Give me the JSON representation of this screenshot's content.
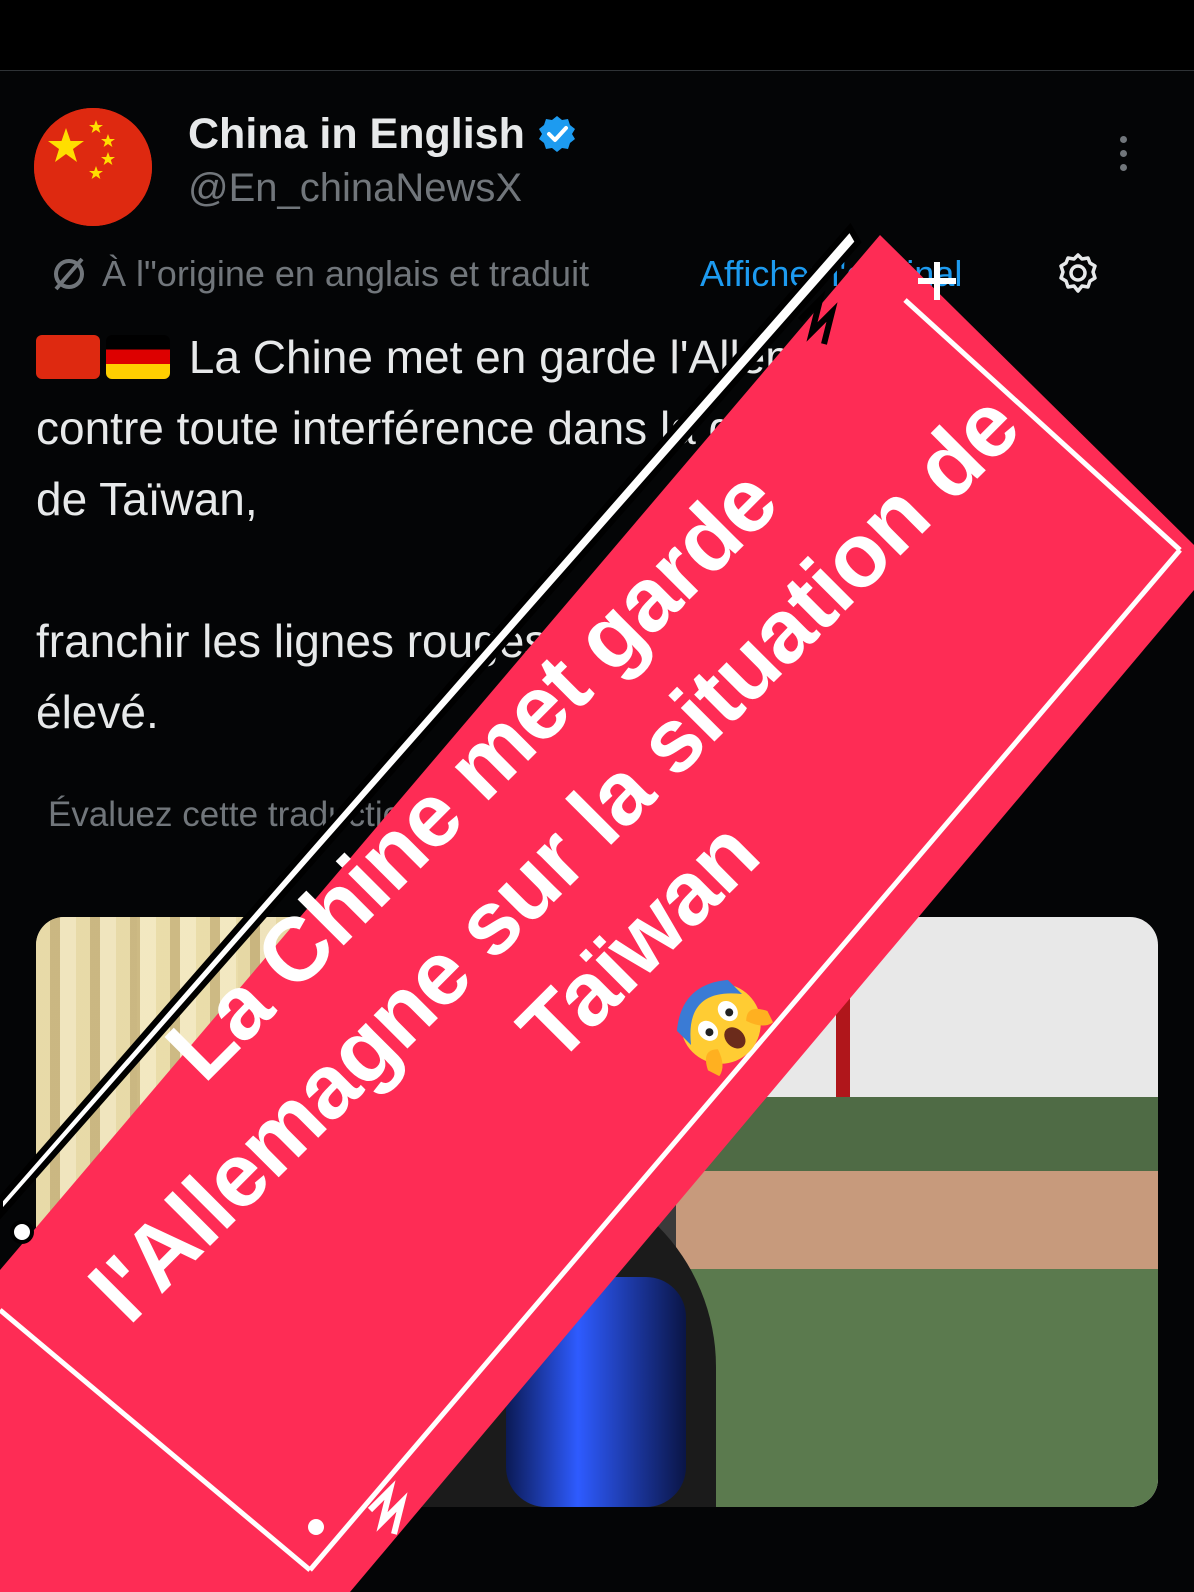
{
  "account": {
    "name": "China in English",
    "handle": "@En_chinaNewsX",
    "verified": true,
    "avatar_icon": "china-flag-icon",
    "verified_color": "#1d9bf0"
  },
  "translation_bar": {
    "text": "À l\"origine en anglais et traduit",
    "link": "Afficher l'original"
  },
  "post": {
    "line1_text": "La Chine met en garde l'Allemagne",
    "line2": "contre toute interférence dans la question",
    "line3": "de Taïwan,",
    "line5": "franchir les lignes rouges aura un coût",
    "line6": "élevé.",
    "rate_translation": "Évaluez cette traduction"
  },
  "overlay": {
    "line1": "La Chine met garde",
    "line2": "l'Allemagne sur la situation de",
    "line3": "Taïwan",
    "emoji": "shocked-face-emoji",
    "banner_color": "#fe2c55"
  },
  "colors": {
    "background": "#000000",
    "text": "#e7e9ea",
    "muted": "#71767b",
    "link": "#1d9bf0"
  }
}
